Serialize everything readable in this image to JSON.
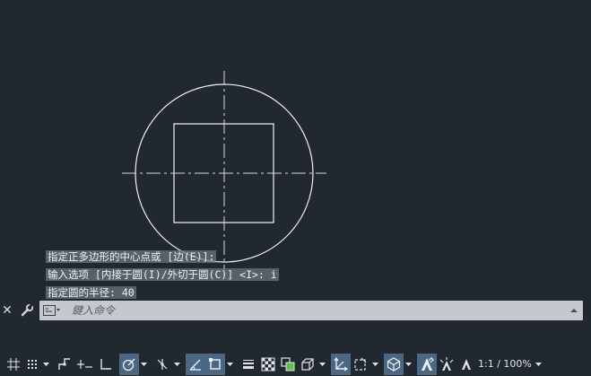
{
  "command_history": [
    "指定正多边形的中心点或 [边(E)]:",
    "输入选项 [内接于圆(I)/外切于圆(C)] <I>: i",
    "指定圆的半径: 40"
  ],
  "command_line": {
    "placeholder": "鍵入命令",
    "value": ""
  },
  "status_bar": {
    "scale": "1:1 / 100%"
  },
  "colors": {
    "canvas": "#212830",
    "geometry": "#ffffff",
    "active_toggle": "#4a6783",
    "command_field": "#c6c9cc"
  },
  "icons": [
    "close-icon",
    "wrench-icon",
    "command-prompt-icon",
    "chevron-up-icon",
    "grid-icon",
    "snap-icon",
    "infer-constraints-icon",
    "dynamic-input-icon",
    "ortho-icon",
    "polar-icon",
    "isodraft-icon",
    "object-snap-tracking-icon",
    "object-snap-icon",
    "lineweight-icon",
    "transparency-icon",
    "selection-cycling-icon",
    "3d-osnap-icon",
    "dynamic-ucs-icon",
    "selection-filter-icon",
    "gizmo-icon",
    "annotation-visibility-icon",
    "auto-scale-icon",
    "annotation-scale-icon"
  ]
}
